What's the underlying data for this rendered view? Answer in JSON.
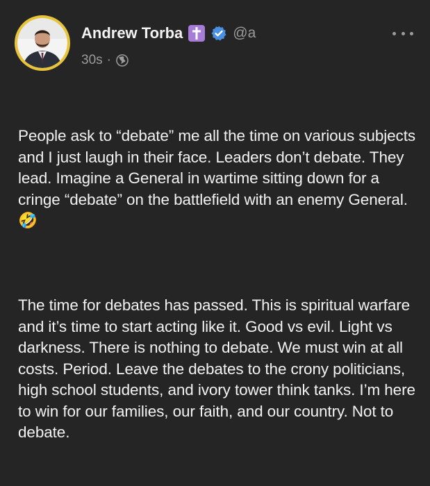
{
  "post": {
    "author_name": "Andrew Torba",
    "badge_icon": "cross-icon",
    "verified_icon": "verified-check-icon",
    "handle": "@a",
    "time": "30s",
    "separator": "·",
    "visibility_icon": "globe-icon",
    "more_icon": "more-horizontal-icon",
    "paragraphs": [
      "People ask to “debate” me all the time on various subjects and I just laugh in their face. Leaders don’t debate. They lead. Imagine a General in wartime sitting down for a cringe “debate” on the battlefield with an enemy General. 🤣",
      "The time for debates has passed. This is spiritual warfare and it’s time to start acting like it. Good vs evil. Light vs darkness. There is nothing to debate. We must win at all costs. Period. Leave the debates to the crony politicians, high school students, and ivory tower think tanks. I’m here to win for our families, our faith, and our country. Not to debate."
    ]
  },
  "colors": {
    "background": "#252525",
    "text": "#f2f2f2",
    "muted": "#9b9b9b",
    "avatar_ring": "#e7c43a",
    "cross_badge": "#a77cd9",
    "verified": "#4a90e2"
  }
}
